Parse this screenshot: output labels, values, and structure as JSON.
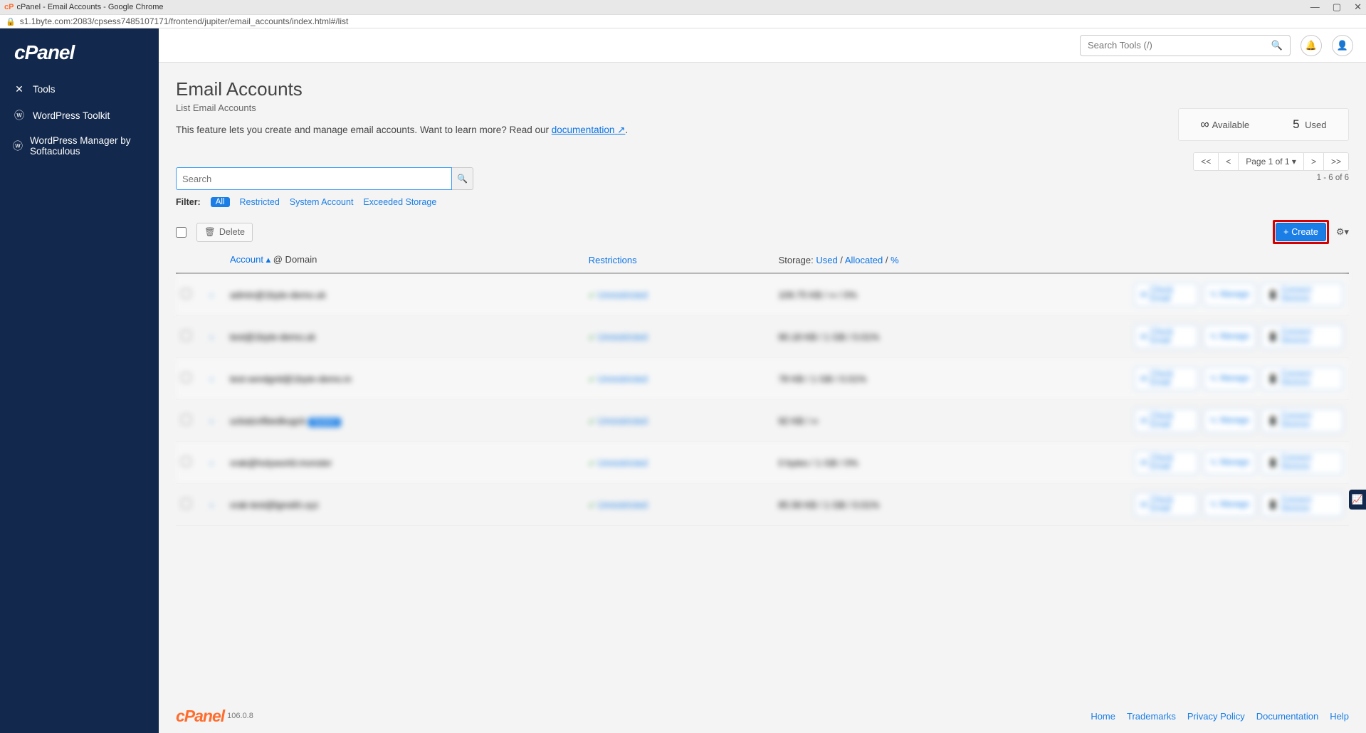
{
  "browser": {
    "title": "cPanel - Email Accounts - Google Chrome",
    "url": "s1.1byte.com:2083/cpsess7485107171/frontend/jupiter/email_accounts/index.html#/list"
  },
  "sidebar": {
    "logo": "cPanel",
    "items": [
      {
        "icon": "✕",
        "label": "Tools"
      },
      {
        "icon": "ⓦ",
        "label": "WordPress Toolkit"
      },
      {
        "icon": "ⓦ",
        "label": "WordPress Manager by Softaculous"
      }
    ]
  },
  "header": {
    "search_placeholder": "Search Tools (/)"
  },
  "page": {
    "title": "Email Accounts",
    "subtitle": "List Email Accounts",
    "desc_prefix": "This feature lets you create and manage email accounts. Want to learn more? Read our ",
    "desc_link": "documentation",
    "desc_link_icon": "↗",
    "desc_suffix": "."
  },
  "stats": {
    "available_icon": "∞",
    "available_label": "Available",
    "used_count": "5",
    "used_label": "Used"
  },
  "search": {
    "placeholder": "Search"
  },
  "filters": {
    "label": "Filter:",
    "all": "All",
    "restricted": "Restricted",
    "system": "System Account",
    "exceeded": "Exceeded Storage"
  },
  "pagination": {
    "first": "<<",
    "prev": "<",
    "page_text": "Page 1 of 1 ▾",
    "next": ">",
    "last": ">>",
    "range": "1 - 6 of 6"
  },
  "actions": {
    "delete": "Delete",
    "create": "Create"
  },
  "columns": {
    "account": "Account",
    "at_domain": " @ Domain",
    "restrictions": "Restrictions",
    "storage_label": "Storage: ",
    "used": "Used",
    "allocated": "Allocated",
    "percent": "%"
  },
  "row_buttons": {
    "check_email": "Check Email",
    "manage": "Manage",
    "connect": "Connect Devices"
  },
  "rows": [
    {
      "email": "admin@1byte-demo.uk",
      "restriction": "Unrestricted",
      "storage": "109.75 KB / ∞ / 0%",
      "system": false
    },
    {
      "email": "test@1byte-demo.uk",
      "restriction": "Unrestricted",
      "storage": "90.18 KB / 1 GB / 0.01%",
      "system": false
    },
    {
      "email": "test-sendgrid@1byte-demo.in",
      "restriction": "Unrestricted",
      "storage": "78 KB / 1 GB / 0.01%",
      "system": false
    },
    {
      "email": "uckatzvfibedkugck",
      "restriction": "Unrestricted",
      "storage": "92 KB / ∞",
      "system": true
    },
    {
      "email": "vrak@holyworld.monster",
      "restriction": "Unrestricted",
      "storage": "0 bytes / 1 GB / 0%",
      "system": false
    },
    {
      "email": "vrak-test@lgnokh.xyz",
      "restriction": "Unrestricted",
      "storage": "85.58 KB / 1 GB / 0.01%",
      "system": false
    }
  ],
  "system_badge": "System",
  "footer": {
    "logo": "cPanel",
    "version": "106.0.8",
    "links": [
      "Home",
      "Trademarks",
      "Privacy Policy",
      "Documentation",
      "Help"
    ]
  }
}
